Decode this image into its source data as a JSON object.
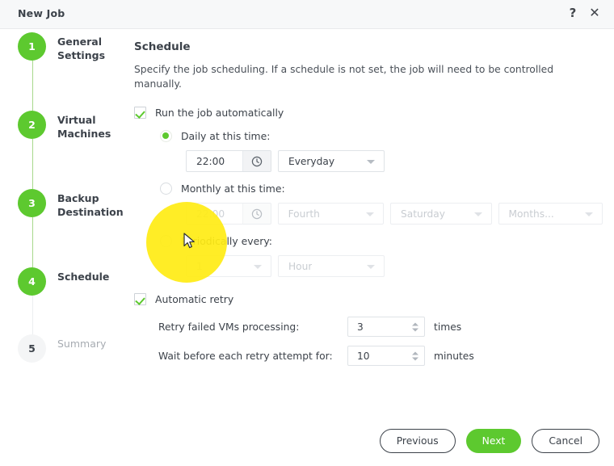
{
  "window": {
    "title": "New Job",
    "help_icon": "question-mark-icon",
    "close_icon": "close-icon"
  },
  "stepper": {
    "steps": [
      {
        "number": "1",
        "label": "General Settings",
        "state": "active"
      },
      {
        "number": "2",
        "label": "Virtual Machines",
        "state": "active"
      },
      {
        "number": "3",
        "label": "Backup Destination",
        "state": "active"
      },
      {
        "number": "4",
        "label": "Schedule",
        "state": "active"
      },
      {
        "number": "5",
        "label": "Summary",
        "state": "inactive"
      }
    ]
  },
  "main": {
    "title": "Schedule",
    "description": "Specify the job scheduling. If a schedule is not set, the job will need to be controlled manually.",
    "run_automatically": {
      "label": "Run the job automatically",
      "checked": "true"
    },
    "daily": {
      "label": "Daily at this time:",
      "selected": "true",
      "time": "22:00",
      "clock_icon": "clock-icon",
      "frequency": "Everyday"
    },
    "monthly": {
      "label": "Monthly at this time:",
      "selected": "false",
      "time": "22:00",
      "clock_icon": "clock-icon",
      "ordinal": "Fourth",
      "weekday": "Saturday",
      "months": "Months..."
    },
    "periodically": {
      "label": "Periodically every:",
      "selected": "false",
      "count": "1",
      "unit": "Hour"
    },
    "automatic_retry": {
      "label": "Automatic retry",
      "checked": "true",
      "retry_label": "Retry failed VMs processing:",
      "retry_value": "3",
      "retry_unit": "times",
      "wait_label": "Wait before each retry attempt for:",
      "wait_value": "10",
      "wait_unit": "minutes"
    }
  },
  "footer": {
    "previous": "Previous",
    "next": "Next",
    "cancel": "Cancel"
  },
  "colors": {
    "accent_green": "#5dc92f",
    "text_dark": "#3c424a",
    "text_muted": "#a7acb2",
    "cursor_highlight": "#ffeb14"
  }
}
